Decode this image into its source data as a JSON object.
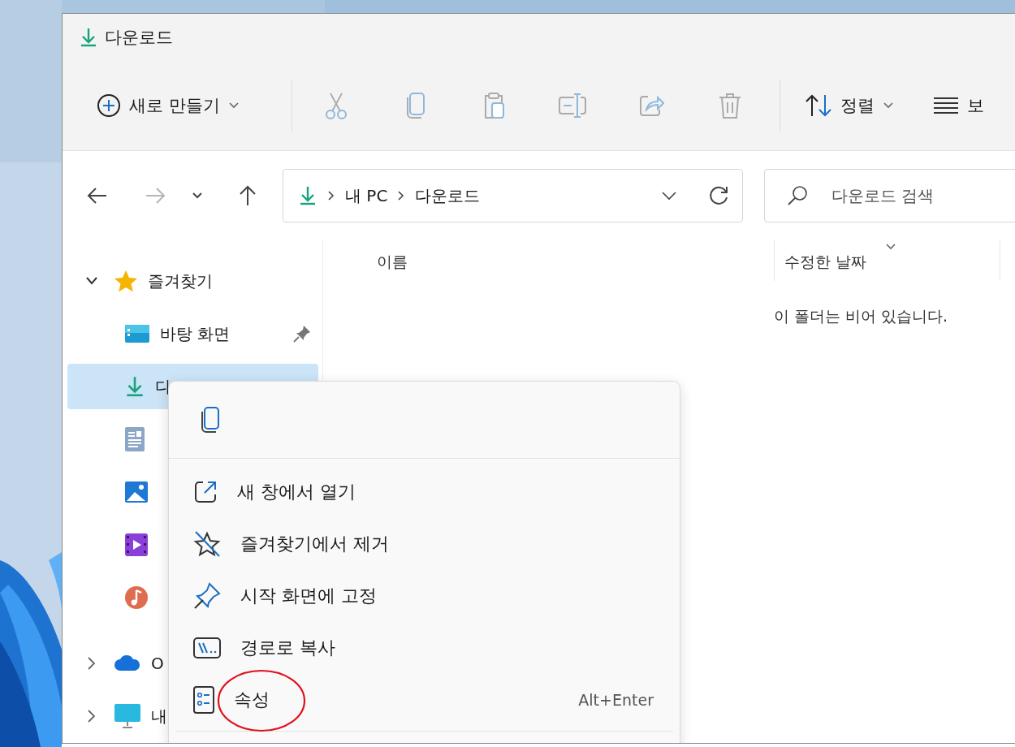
{
  "window": {
    "title": "다운로드"
  },
  "toolbar": [
    {
      "kind": "new",
      "label": "새로 만들기",
      "disabled": false
    },
    {
      "kind": "separator"
    },
    {
      "kind": "cut",
      "disabled": true
    },
    {
      "kind": "copy",
      "disabled": true
    },
    {
      "kind": "paste",
      "disabled": true
    },
    {
      "kind": "rename",
      "disabled": true
    },
    {
      "kind": "share",
      "disabled": true
    },
    {
      "kind": "delete",
      "disabled": true
    },
    {
      "kind": "separator"
    },
    {
      "kind": "sort",
      "label": "정렬",
      "disabled": false
    },
    {
      "kind": "view",
      "label": "보",
      "disabled": false
    }
  ],
  "nav": [
    {
      "kind": "back",
      "disabled": false
    },
    {
      "kind": "forward",
      "disabled": true
    },
    {
      "kind": "recent",
      "disabled": false
    },
    {
      "kind": "up",
      "disabled": false
    }
  ],
  "address": {
    "path": [
      "내 PC",
      "다운로드"
    ]
  },
  "search": {
    "placeholder": "다운로드 검색"
  },
  "sidebar": [
    {
      "kind": "favorites",
      "label": "즐겨찾기",
      "expanded": true,
      "children": [
        {
          "kind": "desktop",
          "label": "바탕 화면",
          "pinned": true,
          "selected": false
        },
        {
          "kind": "downloads",
          "label": "다",
          "pinned": false,
          "selected": true
        },
        {
          "kind": "documents",
          "pinned": false,
          "selected": false
        },
        {
          "kind": "pictures",
          "pinned": false,
          "selected": false
        },
        {
          "kind": "videos",
          "pinned": false,
          "selected": false
        },
        {
          "kind": "music",
          "pinned": false,
          "selected": false
        }
      ]
    },
    {
      "kind": "onedrive",
      "label": "O",
      "expanded": false
    },
    {
      "kind": "pc",
      "label": "내",
      "expanded": false
    }
  ],
  "columns": [
    {
      "label": "이름",
      "sorted": false
    },
    {
      "label": "수정한 날짜",
      "sorted": true
    }
  ],
  "empty_message": "이 폴더는 비어 있습니다.",
  "context_menu": {
    "top_actions": [
      {
        "kind": "copy"
      }
    ],
    "items": [
      {
        "kind": "open-window",
        "label": "새 창에서 열기",
        "circled": false
      },
      {
        "kind": "unfavorite",
        "label": "즐겨찾기에서 제거",
        "circled": false
      },
      {
        "kind": "pin-start",
        "label": "시작 화면에 고정",
        "circled": false
      },
      {
        "kind": "copy-path",
        "label": "경로로 복사",
        "circled": false
      },
      {
        "kind": "properties",
        "label": "속성",
        "shortcut": "Alt+Enter",
        "circled": true
      }
    ]
  }
}
